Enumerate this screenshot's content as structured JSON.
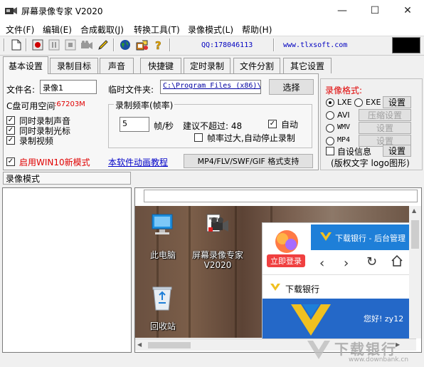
{
  "window": {
    "title": "屏幕录像专家 V2020",
    "minimize": "—",
    "maximize": "☐",
    "close": "✕"
  },
  "menu": [
    "文件(F)",
    "编辑(E)",
    "合成截取(J)",
    "转换工具(T)",
    "录像模式(L)",
    "帮助(H)"
  ],
  "toolbar": {
    "qq": "QQ:178046113",
    "url": "www.tlxsoft.com"
  },
  "tabs": [
    "基本设置",
    "录制目标",
    "声音",
    "快捷键",
    "定时录制",
    "文件分割",
    "其它设置"
  ],
  "basic": {
    "filename_label": "文件名:",
    "filename_value": "录像1",
    "temp_folder_label": "临时文件夹:",
    "temp_folder_value": "C:\\Program Files (x86)\\",
    "browse_button": "选择",
    "disk_space_label": "C盘可用空间",
    "disk_space_value": ":67203M",
    "cb_sound": "同时录制声音",
    "cb_cursor": "同时录制光标",
    "cb_video": "录制视频",
    "cb_win10": "启用WIN10新模式",
    "rate_group_title": "录制频率(帧率)",
    "rate_value": "5",
    "rate_unit": "帧/秒",
    "rate_suggest": "建议不超过: 48",
    "cb_auto": "自动",
    "cb_auto_stop": "帧率过大,自动停止录制",
    "tutorial_link": "本软件动画教程",
    "format_support_button": "MP4/FLV/SWF/GIF 格式支持"
  },
  "format": {
    "title": "录像格式:",
    "lxe": "LXE",
    "exe": "EXE",
    "avi": "AVI",
    "wmv": "WMV",
    "mp4": "MP4",
    "settings": "设置",
    "compress_settings": "压缩设置",
    "cb_custom_info": "自设信息",
    "custom_info_button": "设置",
    "footer": "(版权文字 logo图形)"
  },
  "mode_bar": {
    "label": "录像模式"
  },
  "desktop": {
    "icon_pc": "此电脑",
    "icon_app_line1": "屏幕录像专家",
    "icon_app_line2": "V2020",
    "icon_recycle": "回收站",
    "browser_tab": "下载银行 - 后台管理",
    "login_badge": "立即登录",
    "site_name": "下载银行",
    "greeting": "您好! zy12"
  },
  "watermark": {
    "main": "下载银行",
    "url": "www.downbank.cn"
  }
}
